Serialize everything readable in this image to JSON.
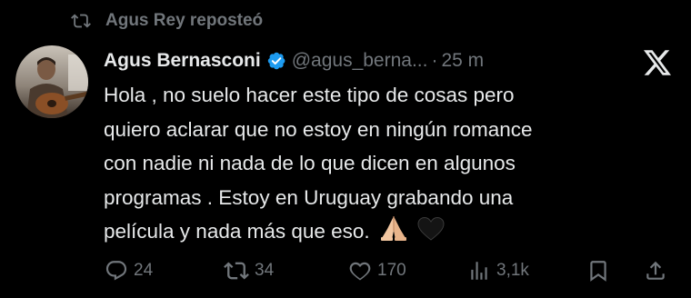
{
  "repost": {
    "icon": "repost-icon",
    "text": "Agus Rey reposteó"
  },
  "author": {
    "avatar": "avatar",
    "display_name": "Agus Bernasconi",
    "verified_icon": "verified-badge-icon",
    "handle": "@agus_berna...",
    "separator": "·",
    "time": "25 m"
  },
  "platform_icon": "x-logo-icon",
  "tweet": {
    "lines": [
      "Hola , no suelo hacer este tipo de cosas pero",
      "quiero aclarar que no estoy en ningún romance",
      "con nadie ni nada de lo que dicen en algunos",
      "programas . Estoy en Uruguay grabando una",
      "película y nada más que eso."
    ],
    "emojis": [
      "praying-hands-emoji",
      "black-heart-emoji"
    ]
  },
  "actions": {
    "reply": {
      "icon": "reply-icon",
      "count": "24"
    },
    "repost": {
      "icon": "repost-icon",
      "count": "34"
    },
    "like": {
      "icon": "heart-icon",
      "count": "170"
    },
    "views": {
      "icon": "views-icon",
      "count": "3,1k"
    },
    "bookmark": {
      "icon": "bookmark-icon"
    },
    "share": {
      "icon": "share-icon"
    }
  },
  "colors": {
    "background": "#000000",
    "text": "#e7e9ea",
    "secondary": "#71767b",
    "verified": "#1d9bf0"
  }
}
